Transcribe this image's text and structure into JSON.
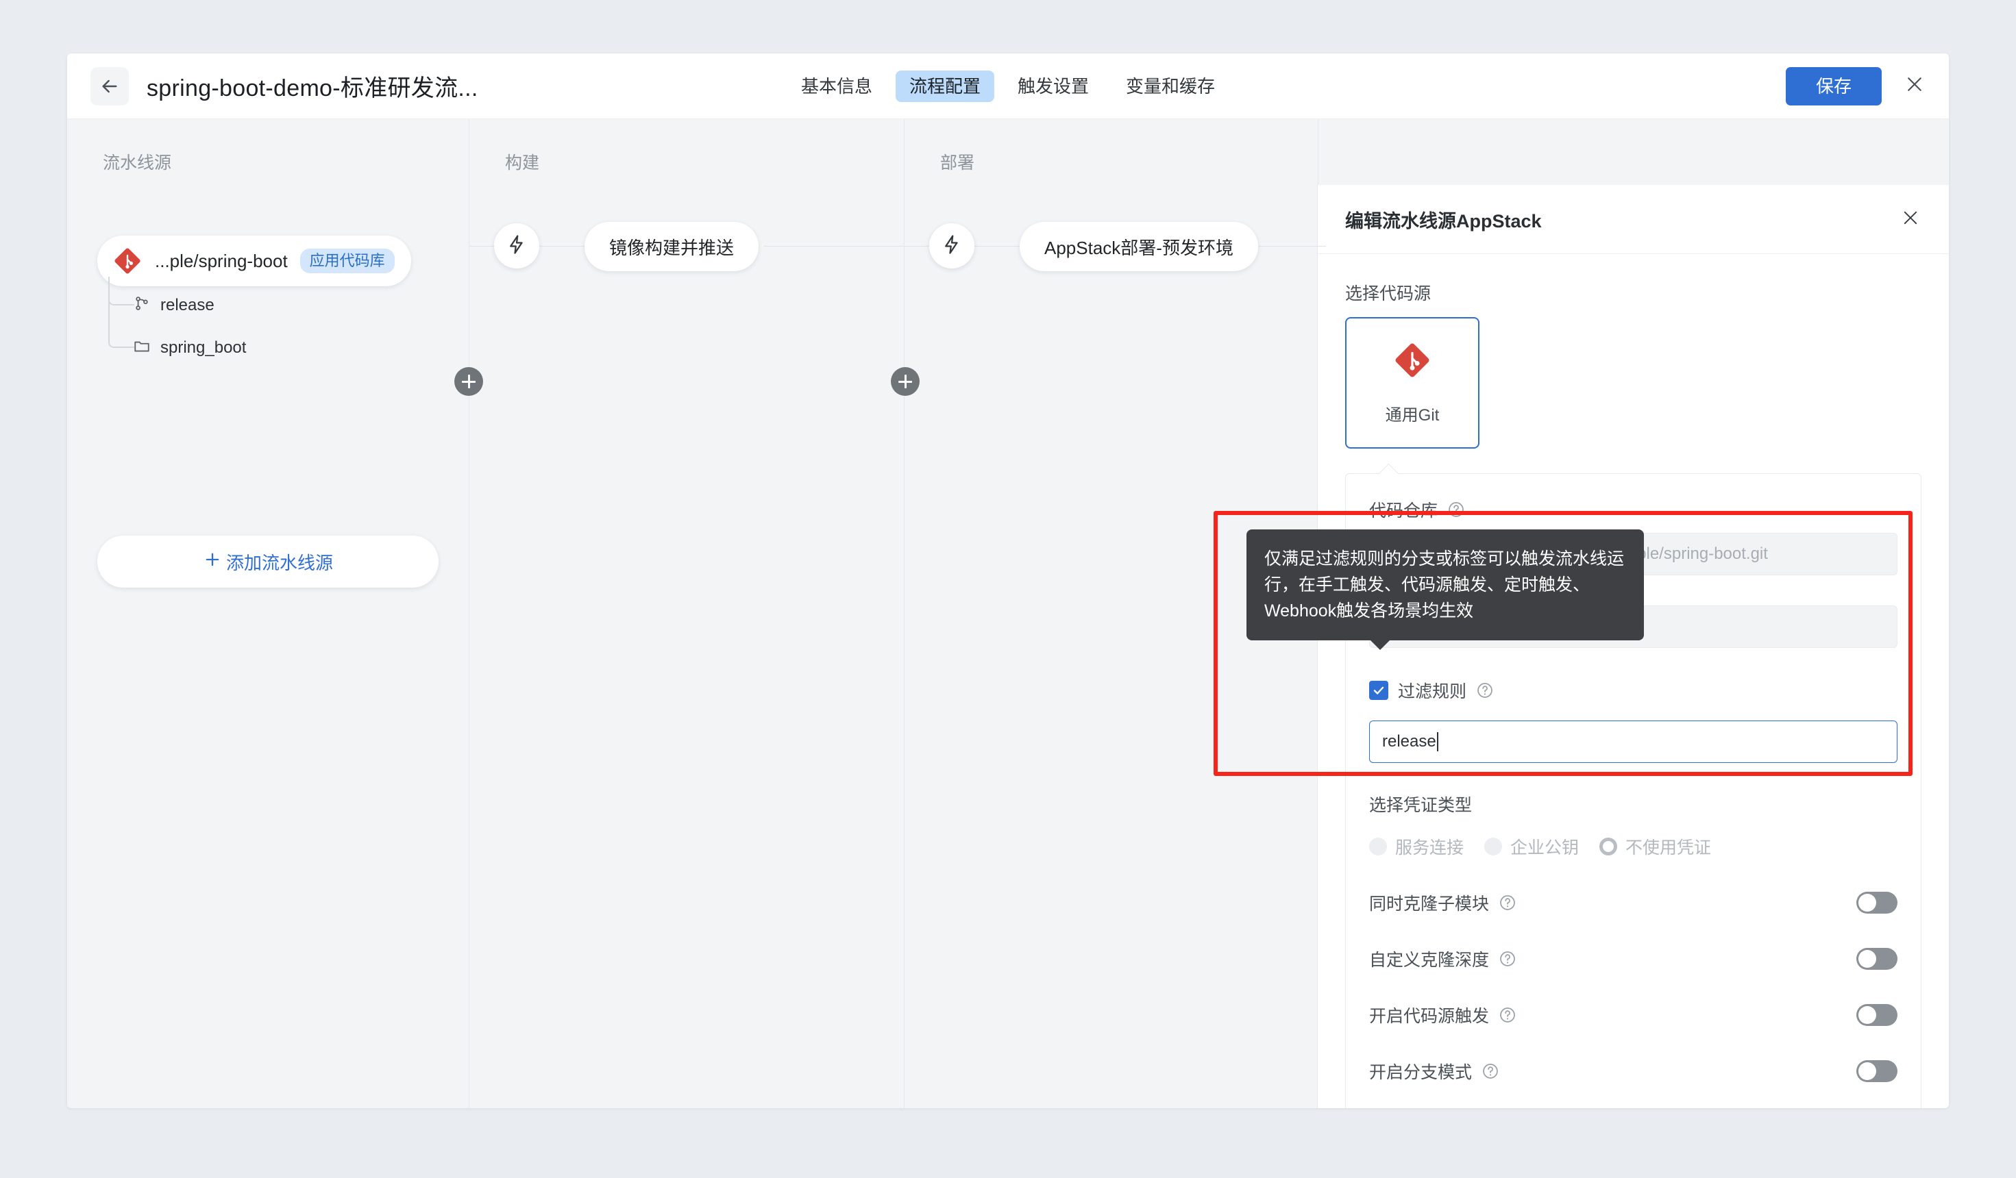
{
  "header": {
    "back_icon": "arrow-left-icon",
    "pipeline_title": "spring-boot-demo-标准研发流...",
    "tabs": [
      {
        "label": "基本信息",
        "active": false
      },
      {
        "label": "流程配置",
        "active": true
      },
      {
        "label": "触发设置",
        "active": false
      },
      {
        "label": "变量和缓存",
        "active": false
      }
    ],
    "save_label": "保存",
    "close_icon": "close-icon",
    "accent_color": "#2f6fd4",
    "active_tab_bg": "#bddcfc"
  },
  "canvas": {
    "stages": [
      {
        "title": "流水线源"
      },
      {
        "title": "构建"
      },
      {
        "title": "部署"
      }
    ],
    "source_node": {
      "icon": "git-icon",
      "label": "...ple/spring-boot",
      "tag": "应用代码库",
      "tag_bg": "#d4e6fb",
      "tag_color": "#2a6fc4"
    },
    "source_tree": [
      {
        "icon": "branch-icon",
        "label": "release"
      },
      {
        "icon": "folder-icon",
        "label": "spring_boot"
      }
    ],
    "add_source_label": "添加流水线源",
    "add_source_icon": "plus-icon",
    "build_task": {
      "icon": "lightning-icon",
      "label": "镜像构建并推送"
    },
    "deploy_task": {
      "icon": "lightning-icon",
      "label": "AppStack部署-预发环境"
    },
    "add_stage_icon": "plus-icon"
  },
  "panel": {
    "title": "编辑流水线源AppStack",
    "close_icon": "close-icon",
    "source_type_label": "选择代码源",
    "source_card": {
      "icon": "git-icon",
      "name": "通用Git",
      "selected": true,
      "border_color": "#2f6fd4"
    },
    "repo_label": "代码仓库",
    "repo_help_icon": "question-circle-icon",
    "repo_value": "https://atomgit.com/appstack-example/spring-boot.git",
    "branch_value": "",
    "filter_rule": {
      "label": "过滤规则",
      "checked": true,
      "help_icon": "question-circle-icon",
      "value": "release"
    },
    "credential_label": "选择凭证类型",
    "credential_options": [
      {
        "label": "服务连接",
        "selected": false
      },
      {
        "label": "企业公钥",
        "selected": false
      },
      {
        "label": "不使用凭证",
        "selected": true
      }
    ],
    "toggles": [
      {
        "label": "同时克隆子模块",
        "help_icon": "question-circle-icon",
        "on": false
      },
      {
        "label": "自定义克隆深度",
        "help_icon": "question-circle-icon",
        "on": false
      },
      {
        "label": "开启代码源触发",
        "help_icon": "question-circle-icon",
        "on": false
      },
      {
        "label": "开启分支模式",
        "help_icon": "question-circle-icon",
        "on": false
      }
    ]
  },
  "tooltip": {
    "text": "仅满足过滤规则的分支或标签可以触发流水线运行，在手工触发、代码源触发、定时触发、Webhook触发各场景均生效",
    "bg": "#3f4043"
  },
  "annotation": {
    "color": "#f5251b"
  }
}
